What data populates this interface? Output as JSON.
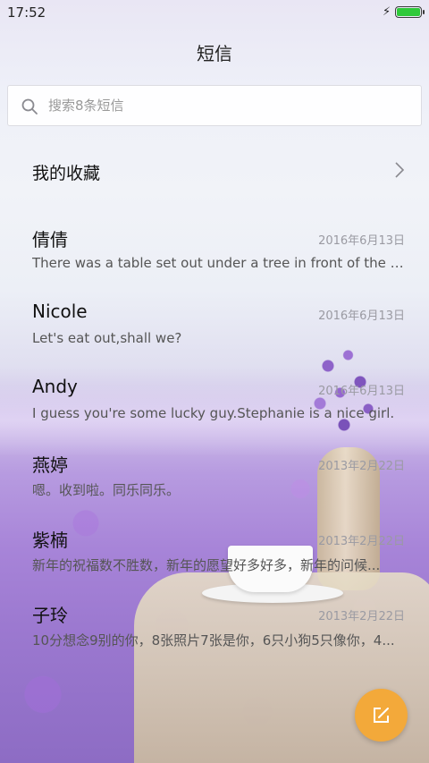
{
  "status_bar": {
    "time": "17:52",
    "battery_level": 1.0
  },
  "header": {
    "title": "短信"
  },
  "search": {
    "placeholder": "搜索8条短信"
  },
  "favorites": {
    "label": "我的收藏"
  },
  "conversations": [
    {
      "name": "倩倩",
      "date": "2016年6月13日",
      "preview": "There was a table set out under a tree in front of the ho..."
    },
    {
      "name": "Nicole",
      "date": "2016年6月13日",
      "preview": "Let's eat out,shall we?"
    },
    {
      "name": "Andy",
      "date": "2016年6月13日",
      "preview": "I guess you're some lucky guy.Stephanie is a nice girl."
    },
    {
      "name": "燕婷",
      "date": "2013年2月22日",
      "preview": "嗯。收到啦。同乐同乐。"
    },
    {
      "name": "紫楠",
      "date": "2013年2月22日",
      "preview": "新年的祝福数不胜数，新年的愿望好多好多，新年的问候..."
    },
    {
      "name": "子玲",
      "date": "2013年2月22日",
      "preview": "10分想念9别的你，8张照片7张是你，6只小狗5只像你，4..."
    }
  ],
  "colors": {
    "accent": "#f3a93a",
    "battery": "#2fc93a",
    "lavender": "#a784d8"
  },
  "icons": {
    "search": "search-icon",
    "chevron": "chevron-right-icon",
    "compose": "compose-icon",
    "charge": "charge-icon"
  }
}
